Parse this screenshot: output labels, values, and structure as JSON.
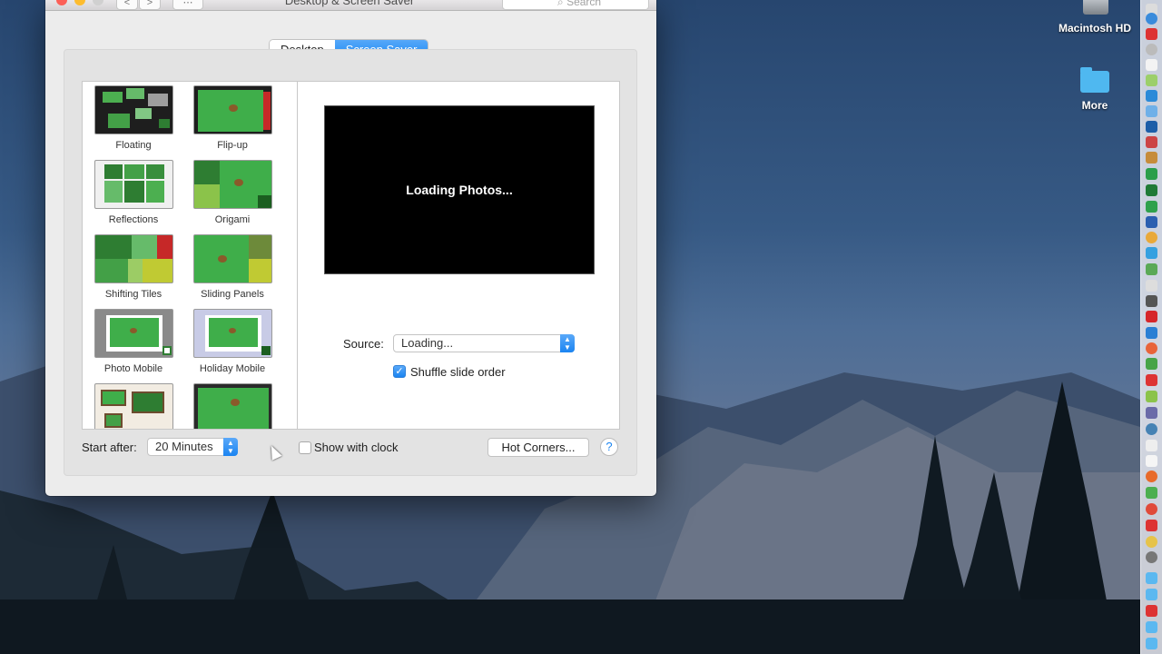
{
  "desktop": {
    "hd_label": "Macintosh HD",
    "folder_label": "More"
  },
  "window": {
    "title": "Desktop & Screen Saver",
    "search_placeholder": "Search",
    "back_glyph": "<",
    "forward_glyph": ">",
    "grid_glyph": "⋯"
  },
  "tabs": [
    {
      "label": "Desktop",
      "active": false
    },
    {
      "label": "Screen Saver",
      "active": true
    }
  ],
  "screen_savers": [
    {
      "label": "Floating"
    },
    {
      "label": "Flip-up"
    },
    {
      "label": "Reflections"
    },
    {
      "label": "Origami"
    },
    {
      "label": "Shifting Tiles"
    },
    {
      "label": "Sliding Panels"
    },
    {
      "label": "Photo Mobile"
    },
    {
      "label": "Holiday Mobile"
    },
    {
      "label": ""
    },
    {
      "label": ""
    }
  ],
  "preview": {
    "status": "Loading Photos..."
  },
  "source": {
    "label": "Source:",
    "value": "Loading..."
  },
  "shuffle": {
    "label": "Shuffle slide order",
    "checked": true
  },
  "start_after": {
    "label": "Start after:",
    "value": "20 Minutes"
  },
  "show_clock": {
    "label": "Show with clock",
    "checked": false
  },
  "hot_corners": {
    "label": "Hot Corners..."
  },
  "help": {
    "glyph": "?"
  },
  "colors": {
    "accent": "#1b88f3",
    "thumb_green": "#3fae4a"
  }
}
